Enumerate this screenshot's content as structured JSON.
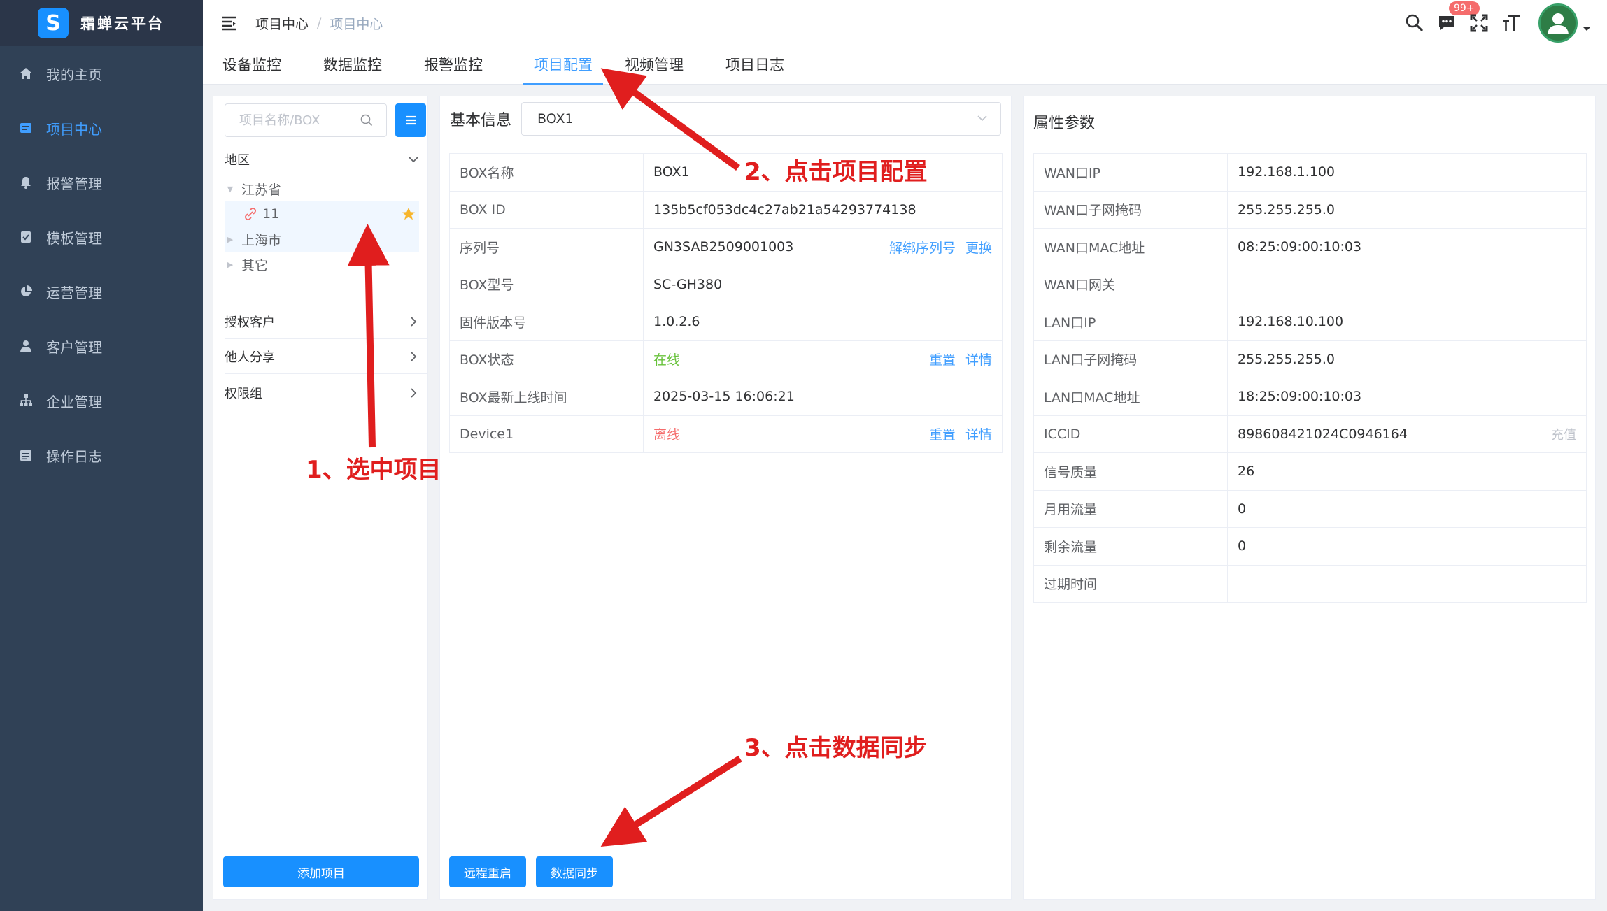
{
  "app": {
    "logo_letter": "S",
    "name": "霜蝉云平台",
    "accent_color": "#1890ff",
    "sidebar_bg": "#304156"
  },
  "sidebar": {
    "items": [
      {
        "label": "我的主页",
        "icon": "home-icon"
      },
      {
        "label": "项目中心",
        "icon": "project-icon"
      },
      {
        "label": "报警管理",
        "icon": "bell-icon"
      },
      {
        "label": "模板管理",
        "icon": "template-icon"
      },
      {
        "label": "运营管理",
        "icon": "pie-chart-icon"
      },
      {
        "label": "客户管理",
        "icon": "user-icon"
      },
      {
        "label": "企业管理",
        "icon": "org-icon"
      },
      {
        "label": "操作日志",
        "icon": "log-icon"
      }
    ],
    "active": "项目中心"
  },
  "header": {
    "breadcrumb": [
      "项目中心",
      "项目中心"
    ],
    "breadcrumb_sep": "/",
    "notification_badge": "99+"
  },
  "tabs": {
    "items": [
      "设备监控",
      "数据监控",
      "报警监控",
      "项目配置",
      "视频管理",
      "项目日志"
    ],
    "active": "项目配置"
  },
  "left_panel": {
    "search_placeholder": "项目名称/BOX",
    "region_label": "地区",
    "tree": [
      {
        "label": "江苏省",
        "expanded": true
      },
      {
        "label": "11",
        "selected": true,
        "starred": true
      },
      {
        "label": "上海市",
        "expanded": false
      },
      {
        "label": "其它",
        "expanded": false
      }
    ],
    "nav": [
      "授权客户",
      "他人分享",
      "权限组"
    ],
    "add_button": "添加项目"
  },
  "basic_info": {
    "title": "基本信息",
    "selected_box": "BOX1",
    "rows": [
      {
        "key": "BOX名称",
        "value": "BOX1"
      },
      {
        "key": "BOX ID",
        "value": "135b5cf053dc4c27ab21a54293774138"
      },
      {
        "key": "序列号",
        "value": "GN3SAB2509001003",
        "action1": "解绑序列号",
        "action2": "更换"
      },
      {
        "key": "BOX型号",
        "value": "SC-GH380"
      },
      {
        "key": "固件版本号",
        "value": "1.0.2.6"
      },
      {
        "key": "BOX状态",
        "value": "在线",
        "action1": "重置",
        "action2": "详情"
      },
      {
        "key": "BOX最新上线时间",
        "value": "2025-03-15 16:06:21"
      },
      {
        "key": "Device1",
        "value": "离线",
        "action1": "重置",
        "action2": "详情"
      }
    ],
    "buttons": {
      "reboot": "远程重启",
      "sync": "数据同步"
    }
  },
  "attributes": {
    "title": "属性参数",
    "rows": [
      {
        "key": "WAN口IP",
        "value": "192.168.1.100"
      },
      {
        "key": "WAN口子网掩码",
        "value": "255.255.255.0"
      },
      {
        "key": "WAN口MAC地址",
        "value": "08:25:09:00:10:03"
      },
      {
        "key": "WAN口网关",
        "value": ""
      },
      {
        "key": "LAN口IP",
        "value": "192.168.10.100"
      },
      {
        "key": "LAN口子网掩码",
        "value": "255.255.255.0"
      },
      {
        "key": "LAN口MAC地址",
        "value": "18:25:09:00:10:03"
      },
      {
        "key": "ICCID",
        "value": "898608421024C0946164",
        "action": "充值"
      },
      {
        "key": "信号质量",
        "value": "26"
      },
      {
        "key": "月用流量",
        "value": "0"
      },
      {
        "key": "剩余流量",
        "value": "0"
      },
      {
        "key": "过期时间",
        "value": ""
      }
    ]
  },
  "annotations": {
    "step1": "1、选中项目",
    "step2": "2、点击项目配置",
    "step3": "3、点击数据同步",
    "color": "#e01e1e"
  }
}
